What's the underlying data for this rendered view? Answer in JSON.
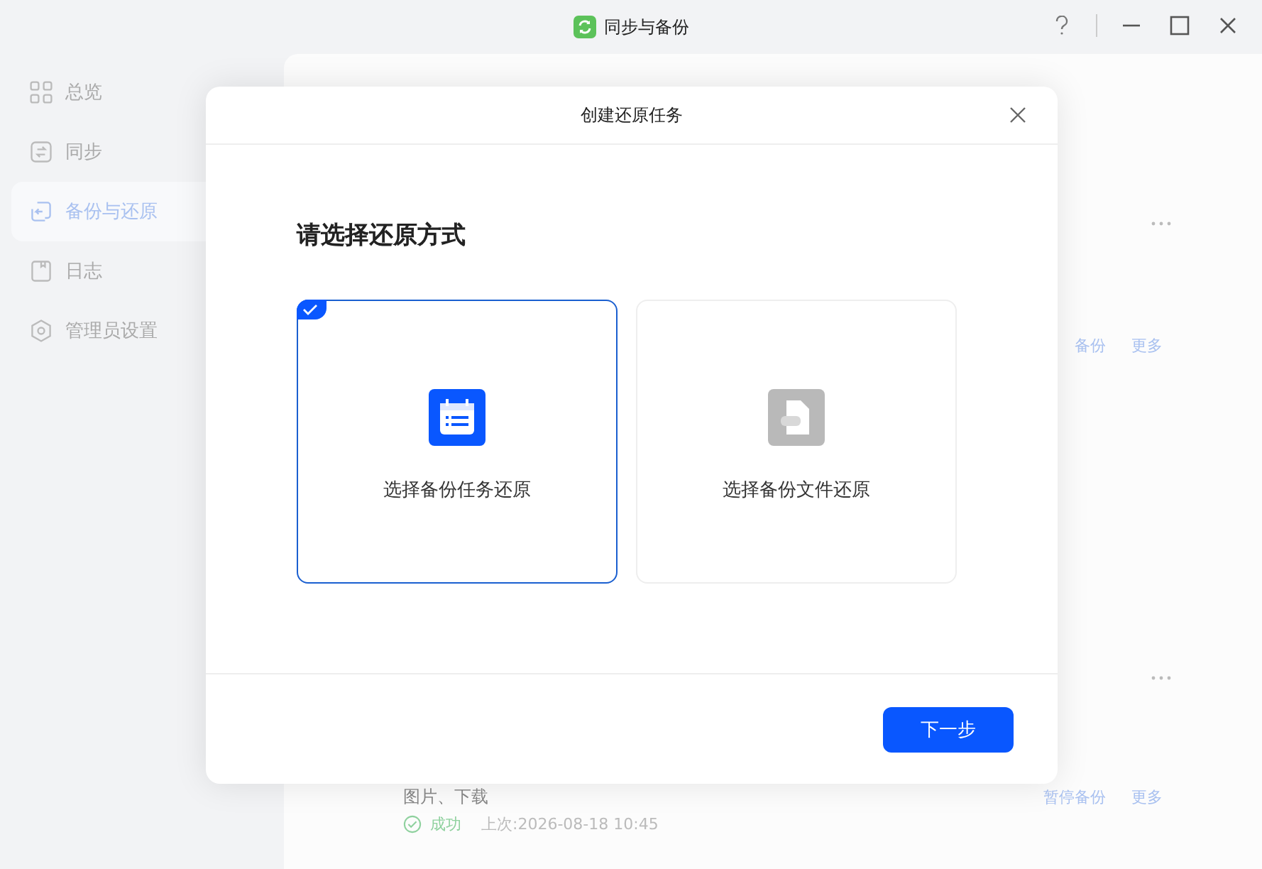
{
  "window": {
    "title": "同步与备份"
  },
  "sidebar": {
    "items": [
      {
        "label": "总览",
        "selected": false
      },
      {
        "label": "同步",
        "selected": false
      },
      {
        "label": "备份与还原",
        "selected": true
      },
      {
        "label": "日志",
        "selected": false
      },
      {
        "label": "管理员设置",
        "selected": false
      }
    ]
  },
  "tasks": [
    {
      "actions": [
        "备份",
        "更多"
      ]
    },
    {
      "title": "图片、下载",
      "status": "成功",
      "last_run": "上次:2026-08-18 10:45",
      "actions": [
        "暂停备份",
        "更多"
      ]
    }
  ],
  "dialog": {
    "title": "创建还原任务",
    "heading": "请选择还原方式",
    "options": [
      {
        "label": "选择备份任务还原",
        "selected": true
      },
      {
        "label": "选择备份文件还原",
        "selected": false
      }
    ],
    "next_button": "下一步"
  }
}
